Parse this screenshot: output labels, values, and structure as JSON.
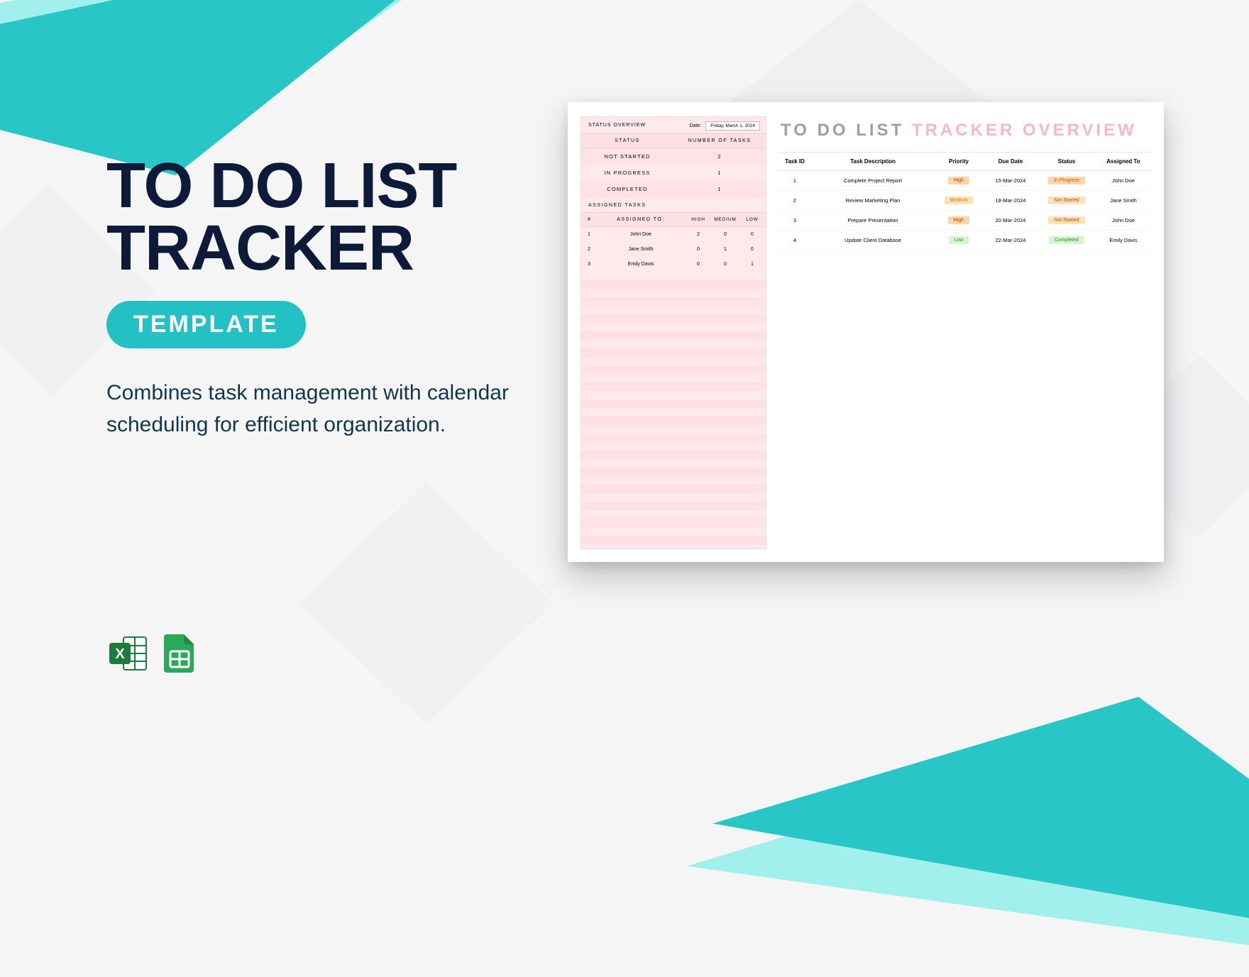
{
  "heading_line1": "TO DO LIST",
  "heading_line2": "TRACKER",
  "badge": "TEMPLATE",
  "subtitle": "Combines task management with calendar scheduling for efficient organization.",
  "icons": {
    "excel": "excel-icon",
    "sheets": "google-sheets-icon"
  },
  "preview": {
    "title_gray": "TO DO LIST",
    "title_pink": "TRACKER OVERVIEW",
    "left": {
      "overview_label": "STATUS OVERVIEW",
      "date_label": "Date:",
      "date_value": "Friday, March 1, 2024",
      "status_head": {
        "status": "STATUS",
        "num": "NUMBER OF TASKS"
      },
      "status_rows": [
        {
          "label": "NOT STARTED",
          "count": "2"
        },
        {
          "label": "IN PROGRESS",
          "count": "1"
        },
        {
          "label": "COMPLETED",
          "count": "1"
        }
      ],
      "assigned_label": "ASSIGNED TASKS",
      "assigned_head": {
        "num": "#",
        "assigned": "ASSIGNED TO:",
        "high": "HIGH",
        "medium": "MEDIUM",
        "low": "LOW"
      },
      "assigned_rows": [
        {
          "n": "1",
          "name": "John Doe",
          "high": "2",
          "medium": "0",
          "low": "0"
        },
        {
          "n": "2",
          "name": "Jane Smith",
          "high": "0",
          "medium": "1",
          "low": "0"
        },
        {
          "n": "3",
          "name": "Emily Davis",
          "high": "0",
          "medium": "0",
          "low": "1"
        }
      ]
    },
    "table": {
      "headers": {
        "id": "Task ID",
        "desc": "Task Description",
        "pri": "Priority",
        "due": "Due Date",
        "status": "Status",
        "asg": "Assigned To"
      },
      "rows": [
        {
          "id": "1",
          "desc": "Complete Project Report",
          "pri": "High",
          "pri_class": "high",
          "due": "15-Mar-2024",
          "status": "In Progress",
          "st_class": "inprog",
          "asg": "John Doe"
        },
        {
          "id": "2",
          "desc": "Review Marketing Plan",
          "pri": "Medium",
          "pri_class": "medium",
          "due": "18-Mar-2024",
          "status": "Not Started",
          "st_class": "notstart",
          "asg": "Jane Smith"
        },
        {
          "id": "3",
          "desc": "Prepare Presentation",
          "pri": "High",
          "pri_class": "high",
          "due": "20-Mar-2024",
          "status": "Not Started",
          "st_class": "notstart",
          "asg": "John Doe"
        },
        {
          "id": "4",
          "desc": "Update Client Database",
          "pri": "Low",
          "pri_class": "low",
          "due": "22-Mar-2024",
          "status": "Completed",
          "st_class": "completed",
          "asg": "Emily Davis"
        }
      ]
    }
  }
}
